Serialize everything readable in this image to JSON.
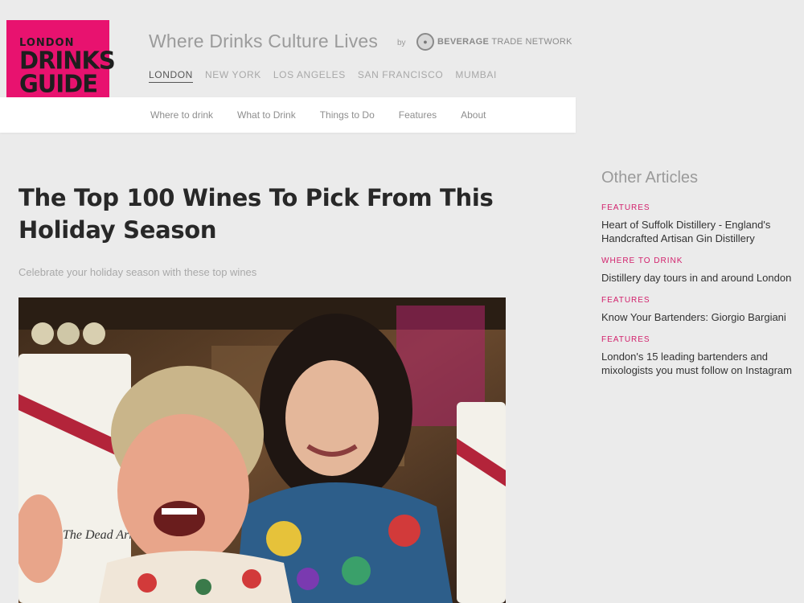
{
  "brand": {
    "logo_line1": "LONDON",
    "logo_line2": "DRINKS",
    "logo_line3": "GUIDE",
    "tagline": "Where Drinks Culture Lives",
    "tagline_by": "by",
    "partner_bold": "BEVERAGE",
    "partner_rest": "TRADE NETWORK",
    "accent_color": "#e8126f"
  },
  "cities": [
    {
      "label": "LONDON",
      "active": true
    },
    {
      "label": "NEW YORK",
      "active": false
    },
    {
      "label": "LOS ANGELES",
      "active": false
    },
    {
      "label": "SAN FRANCISCO",
      "active": false
    },
    {
      "label": "MUMBAI",
      "active": false
    }
  ],
  "nav": [
    {
      "label": "Where to drink"
    },
    {
      "label": "What to Drink"
    },
    {
      "label": "Things to Do"
    },
    {
      "label": "Features"
    },
    {
      "label": "About"
    }
  ],
  "article": {
    "title": "The Top 100 Wines To Pick From This Holiday Season",
    "subtitle": "Celebrate your holiday season with these top wines",
    "image_description": "Two smiling people holding wine bottles"
  },
  "sidebar": {
    "heading": "Other Articles",
    "category_color": "#d21f6b",
    "items": [
      {
        "category": "FEATURES",
        "title": "Heart of Suffolk Distillery - England's Handcrafted Artisan Gin Distillery"
      },
      {
        "category": "WHERE TO DRINK",
        "title": "Distillery day tours in and around London"
      },
      {
        "category": "FEATURES",
        "title": "Know Your Bartenders: Giorgio Bargiani"
      },
      {
        "category": "FEATURES",
        "title": "London's 15 leading bartenders and mixologists you must follow on Instagram"
      }
    ]
  }
}
